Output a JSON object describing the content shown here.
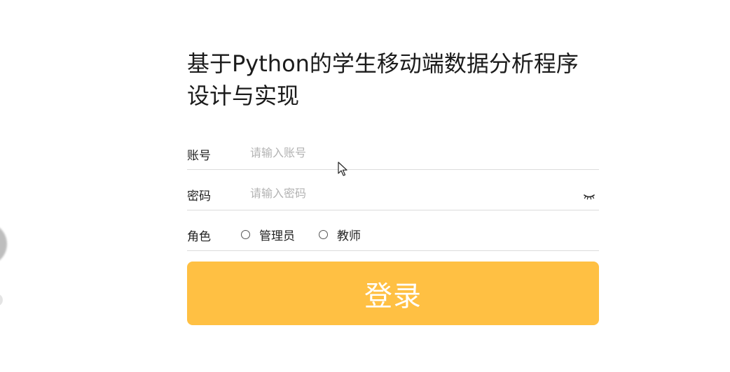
{
  "page": {
    "title": "基于Python的学生移动端数据分析程序设计与实现"
  },
  "form": {
    "account": {
      "label": "账号",
      "placeholder": "请输入账号",
      "value": ""
    },
    "password": {
      "label": "密码",
      "placeholder": "请输入密码",
      "value": "",
      "toggle_icon": "eye-closed-icon"
    },
    "role": {
      "label": "角色",
      "options": [
        {
          "label": "管理员",
          "selected": false
        },
        {
          "label": "教师",
          "selected": false
        }
      ]
    },
    "submit_label": "登录"
  },
  "theme": {
    "accent": "#ffc043",
    "border": "#dcdcdc",
    "placeholder": "#b3b3b3"
  }
}
